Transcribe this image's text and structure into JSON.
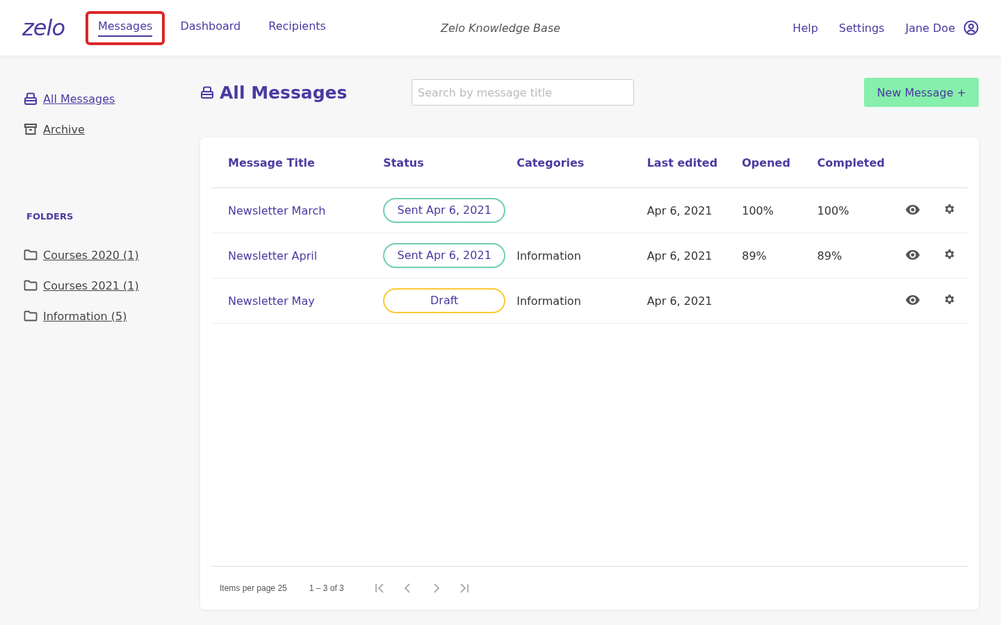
{
  "header": {
    "logo": "zelo",
    "nav": [
      {
        "label": "Messages",
        "selected": true,
        "highlighted": true
      },
      {
        "label": "Dashboard",
        "selected": false,
        "highlighted": false
      },
      {
        "label": "Recipients",
        "selected": false,
        "highlighted": false
      }
    ],
    "center_title": "Zelo Knowledge Base",
    "links": [
      "Help",
      "Settings"
    ],
    "user": "Jane Doe"
  },
  "sidebar": {
    "items": [
      {
        "label": "All Messages",
        "kind": "inbox"
      },
      {
        "label": "Archive",
        "kind": "archive"
      }
    ],
    "folders_heading": "FOLDERS",
    "folders": [
      "Courses 2020 (1)",
      "Courses 2021 (1)",
      "Information (5)"
    ]
  },
  "page": {
    "title": "All Messages",
    "search": {
      "placeholder": "Search by message title"
    },
    "new_button": "New Message +"
  },
  "table": {
    "columns": [
      "Message Title",
      "Status",
      "Categories",
      "Last edited",
      "Opened",
      "Completed"
    ],
    "rows": [
      {
        "title": "Newsletter March",
        "status": {
          "label": "Sent Apr 6, 2021",
          "kind": "sent"
        },
        "category": "",
        "last_edited": "Apr 6, 2021",
        "opened": "100%",
        "completed": "100%"
      },
      {
        "title": "Newsletter April",
        "status": {
          "label": "Sent Apr 6, 2021",
          "kind": "sent"
        },
        "category": "Information",
        "last_edited": "Apr 6, 2021",
        "opened": "89%",
        "completed": "89%"
      },
      {
        "title": "Newsletter May",
        "status": {
          "label": "Draft",
          "kind": "draft"
        },
        "category": "Information",
        "last_edited": "Apr 6, 2021",
        "opened": "",
        "completed": ""
      }
    ]
  },
  "paginator": {
    "items_per_page": "Items per page 25",
    "range": "1 – 3 of 3",
    "buttons": [
      {
        "kind": "first",
        "disabled": true
      },
      {
        "kind": "prev",
        "disabled": true
      },
      {
        "kind": "next",
        "disabled": true
      },
      {
        "kind": "last",
        "disabled": true
      }
    ]
  }
}
